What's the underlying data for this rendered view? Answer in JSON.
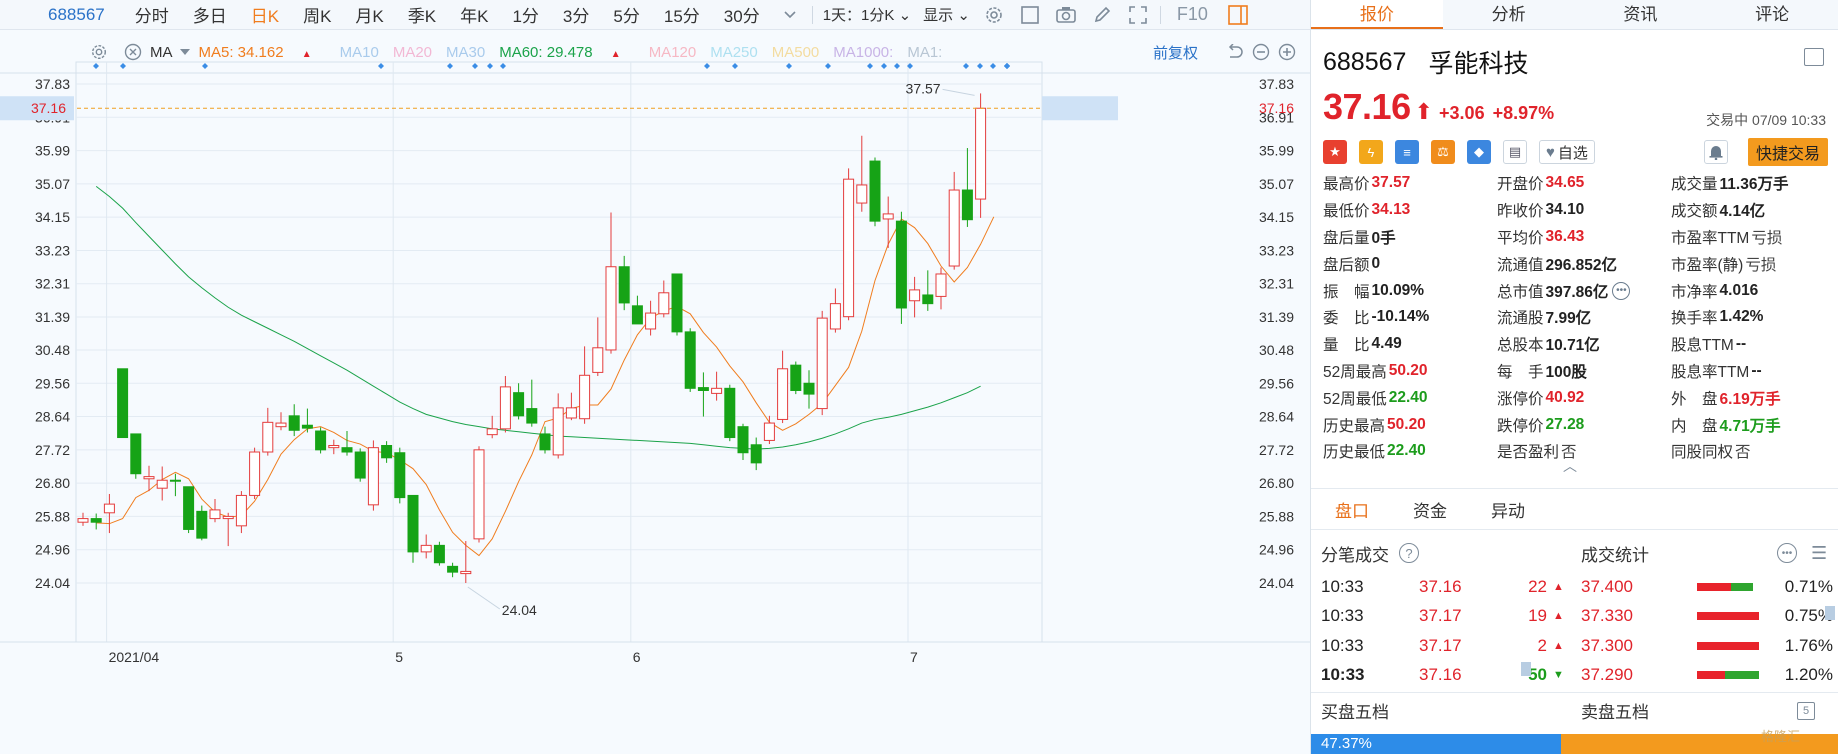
{
  "toolbar": {
    "code": "688567",
    "items": [
      "分时",
      "多日",
      "日K",
      "周K",
      "月K",
      "季K",
      "年K",
      "1分",
      "3分",
      "5分",
      "15分",
      "30分"
    ],
    "active_item": "日K",
    "range": "1天：1分K",
    "display": "显示",
    "f10": "F10"
  },
  "ma_bar": {
    "type": "MA",
    "ma5": "MA5: 34.162",
    "ma10": "MA10",
    "ma20": "MA20",
    "ma30": "MA30",
    "ma60": "MA60: 29.478",
    "ma120": "MA120",
    "ma250": "MA250",
    "ma500": "MA500",
    "ma1000": "MA1000:",
    "ma1": "MA1:",
    "adjust": "前复权",
    "colors": {
      "ma5": "#f07d1e",
      "ma60": "#1ba34a",
      "ma10": "#9fc6ea",
      "ma20": "#f2b6d4",
      "ma30": "#9fc6ea",
      "ma120": "#f6b8c4",
      "ma250": "#aee0f0",
      "ma500": "#f3dca0",
      "ma1000": "#c8b4e6",
      "ma1": "#b8c6d4"
    }
  },
  "chart_data": {
    "type": "candlestick",
    "y_ticks": [
      "37.83",
      "36.91",
      "35.99",
      "35.07",
      "34.15",
      "33.23",
      "32.31",
      "31.39",
      "30.48",
      "29.56",
      "28.64",
      "27.72",
      "26.80",
      "25.88",
      "24.96",
      "24.04"
    ],
    "ylim": [
      24.04,
      37.83
    ],
    "x_labels": [
      {
        "label": "2021/04",
        "index": 1
      },
      {
        "label": "5",
        "index": 24
      },
      {
        "label": "6",
        "index": 42
      },
      {
        "label": "7",
        "index": 63
      }
    ],
    "current_price_label": "37.16",
    "current_price": 37.16,
    "max_label": "37.57",
    "min_label": "24.04",
    "candles": [
      {
        "o": 25.72,
        "c": 25.82,
        "h": 25.98,
        "l": 25.62
      },
      {
        "o": 25.82,
        "c": 25.72,
        "h": 25.96,
        "l": 25.52
      },
      {
        "o": 25.98,
        "c": 26.22,
        "h": 26.5,
        "l": 25.42
      },
      {
        "o": 29.96,
        "c": 28.06,
        "h": 29.96,
        "l": 28.06
      },
      {
        "o": 28.16,
        "c": 27.06,
        "h": 28.16,
        "l": 26.92
      },
      {
        "o": 26.92,
        "c": 26.98,
        "h": 27.28,
        "l": 26.58
      },
      {
        "o": 26.66,
        "c": 26.88,
        "h": 27.26,
        "l": 26.32
      },
      {
        "o": 26.88,
        "c": 26.86,
        "h": 27.06,
        "l": 26.44
      },
      {
        "o": 26.7,
        "c": 25.52,
        "h": 26.7,
        "l": 25.42
      },
      {
        "o": 26.02,
        "c": 25.28,
        "h": 26.18,
        "l": 25.22
      },
      {
        "o": 25.82,
        "c": 26.06,
        "h": 26.36,
        "l": 25.72
      },
      {
        "o": 25.82,
        "c": 25.88,
        "h": 25.98,
        "l": 25.06
      },
      {
        "o": 25.62,
        "c": 26.46,
        "h": 26.58,
        "l": 25.42
      },
      {
        "o": 26.46,
        "c": 27.66,
        "h": 27.78,
        "l": 26.36
      },
      {
        "o": 27.66,
        "c": 28.48,
        "h": 28.88,
        "l": 27.56
      },
      {
        "o": 28.36,
        "c": 28.46,
        "h": 28.76,
        "l": 28.26
      },
      {
        "o": 28.66,
        "c": 28.26,
        "h": 28.98,
        "l": 28.1
      },
      {
        "o": 28.4,
        "c": 28.32,
        "h": 28.86,
        "l": 28.2
      },
      {
        "o": 28.24,
        "c": 27.72,
        "h": 28.34,
        "l": 27.62
      },
      {
        "o": 27.78,
        "c": 27.84,
        "h": 28.0,
        "l": 27.6
      },
      {
        "o": 27.78,
        "c": 27.66,
        "h": 28.24,
        "l": 27.56
      },
      {
        "o": 27.66,
        "c": 26.94,
        "h": 27.76,
        "l": 26.84
      },
      {
        "o": 26.2,
        "c": 27.78,
        "h": 27.98,
        "l": 26.04
      },
      {
        "o": 27.84,
        "c": 27.5,
        "h": 27.96,
        "l": 27.36
      },
      {
        "o": 27.64,
        "c": 26.4,
        "h": 27.78,
        "l": 26.24
      },
      {
        "o": 26.46,
        "c": 24.9,
        "h": 26.46,
        "l": 24.6
      },
      {
        "o": 24.9,
        "c": 25.08,
        "h": 25.38,
        "l": 24.72
      },
      {
        "o": 25.08,
        "c": 24.6,
        "h": 25.18,
        "l": 24.52
      },
      {
        "o": 24.5,
        "c": 24.34,
        "h": 24.6,
        "l": 24.2
      },
      {
        "o": 24.3,
        "c": 24.36,
        "h": 25.2,
        "l": 24.04
      },
      {
        "o": 25.26,
        "c": 27.72,
        "h": 27.82,
        "l": 25.16
      },
      {
        "o": 28.14,
        "c": 28.3,
        "h": 28.66,
        "l": 28.04
      },
      {
        "o": 28.3,
        "c": 29.46,
        "h": 29.76,
        "l": 28.2
      },
      {
        "o": 29.3,
        "c": 28.66,
        "h": 29.56,
        "l": 28.56
      },
      {
        "o": 28.86,
        "c": 28.46,
        "h": 29.66,
        "l": 28.36
      },
      {
        "o": 28.16,
        "c": 27.72,
        "h": 28.36,
        "l": 27.62
      },
      {
        "o": 27.58,
        "c": 28.88,
        "h": 29.28,
        "l": 27.48
      },
      {
        "o": 28.6,
        "c": 28.88,
        "h": 29.3,
        "l": 28.54
      },
      {
        "o": 28.58,
        "c": 29.78,
        "h": 30.58,
        "l": 28.44
      },
      {
        "o": 29.86,
        "c": 30.54,
        "h": 31.38,
        "l": 29.76
      },
      {
        "o": 30.48,
        "c": 32.78,
        "h": 34.28,
        "l": 30.38
      },
      {
        "o": 32.78,
        "c": 31.78,
        "h": 33.08,
        "l": 31.58
      },
      {
        "o": 31.7,
        "c": 31.2,
        "h": 31.98,
        "l": 31.2
      },
      {
        "o": 31.06,
        "c": 31.5,
        "h": 31.84,
        "l": 30.88
      },
      {
        "o": 31.48,
        "c": 32.06,
        "h": 32.4,
        "l": 31.38
      },
      {
        "o": 32.58,
        "c": 30.98,
        "h": 32.58,
        "l": 30.88
      },
      {
        "o": 30.98,
        "c": 29.42,
        "h": 31.08,
        "l": 29.32
      },
      {
        "o": 29.44,
        "c": 29.36,
        "h": 29.86,
        "l": 28.64
      },
      {
        "o": 29.28,
        "c": 29.42,
        "h": 29.88,
        "l": 29.08
      },
      {
        "o": 29.42,
        "c": 28.06,
        "h": 29.52,
        "l": 27.96
      },
      {
        "o": 28.36,
        "c": 27.64,
        "h": 28.44,
        "l": 27.44
      },
      {
        "o": 27.86,
        "c": 27.36,
        "h": 28.06,
        "l": 27.16
      },
      {
        "o": 27.98,
        "c": 28.46,
        "h": 28.66,
        "l": 27.88
      },
      {
        "o": 28.56,
        "c": 29.96,
        "h": 30.46,
        "l": 28.46
      },
      {
        "o": 30.06,
        "c": 29.36,
        "h": 30.16,
        "l": 29.26
      },
      {
        "o": 29.56,
        "c": 29.26,
        "h": 29.92,
        "l": 28.86
      },
      {
        "o": 28.86,
        "c": 31.36,
        "h": 31.56,
        "l": 28.68
      },
      {
        "o": 31.06,
        "c": 31.76,
        "h": 32.18,
        "l": 30.96
      },
      {
        "o": 31.4,
        "c": 35.2,
        "h": 35.5,
        "l": 31.3
      },
      {
        "o": 34.54,
        "c": 35.04,
        "h": 36.4,
        "l": 34.3
      },
      {
        "o": 35.7,
        "c": 34.04,
        "h": 35.8,
        "l": 33.9
      },
      {
        "o": 34.1,
        "c": 34.24,
        "h": 34.72,
        "l": 33.3
      },
      {
        "o": 34.04,
        "c": 31.64,
        "h": 34.3,
        "l": 31.2
      },
      {
        "o": 31.84,
        "c": 32.14,
        "h": 32.5,
        "l": 31.38
      },
      {
        "o": 32.0,
        "c": 31.76,
        "h": 32.68,
        "l": 31.56
      },
      {
        "o": 31.96,
        "c": 32.58,
        "h": 32.76,
        "l": 31.6
      },
      {
        "o": 32.8,
        "c": 34.9,
        "h": 35.4,
        "l": 32.7
      },
      {
        "o": 34.9,
        "c": 34.08,
        "h": 36.06,
        "l": 33.88
      },
      {
        "o": 34.65,
        "c": 37.16,
        "h": 37.57,
        "l": 34.13
      }
    ],
    "ma5": [
      25.7,
      25.68,
      25.82,
      26.4,
      26.6,
      26.9,
      27.1,
      26.92,
      26.36,
      26.0,
      25.86,
      25.9,
      26.3,
      26.9,
      27.6,
      28.0,
      28.3,
      28.36,
      28.2,
      27.98,
      27.88,
      27.68,
      27.64,
      27.44,
      27.2,
      26.76,
      26.06,
      25.44,
      25.08,
      24.8,
      25.26,
      26.02,
      26.84,
      27.58,
      28.5,
      28.6,
      28.86,
      28.96,
      28.96,
      29.4,
      30.2,
      30.9,
      31.36,
      31.56,
      31.68,
      31.48,
      30.96,
      30.56,
      30.04,
      29.6,
      29.02,
      28.48,
      28.26,
      28.44,
      28.7,
      29.0,
      29.5,
      30.0,
      31.0,
      32.4,
      33.4,
      34.1,
      33.86,
      33.42,
      32.8,
      32.36,
      32.76,
      33.4,
      34.16
    ],
    "ma60": [
      null,
      35.0,
      34.72,
      34.4,
      34.0,
      33.62,
      33.24,
      32.86,
      32.5,
      32.2,
      31.92,
      31.66,
      31.44,
      31.26,
      31.08,
      30.9,
      30.72,
      30.52,
      30.32,
      30.12,
      29.92,
      29.7,
      29.48,
      29.26,
      29.04,
      28.86,
      28.7,
      28.6,
      28.5,
      28.42,
      28.36,
      28.3,
      28.26,
      28.22,
      28.18,
      28.14,
      28.1,
      28.08,
      28.06,
      28.04,
      28.02,
      28.0,
      27.98,
      27.96,
      27.94,
      27.92,
      27.9,
      27.86,
      27.82,
      27.78,
      27.76,
      27.74,
      27.76,
      27.8,
      27.86,
      27.94,
      28.04,
      28.16,
      28.3,
      28.46,
      28.56,
      28.62,
      28.7,
      28.8,
      28.9,
      29.02,
      29.16,
      29.3,
      29.48
    ],
    "dot_indices": [
      0,
      1,
      5,
      13,
      16,
      17,
      18,
      19,
      26,
      27,
      32,
      33,
      36,
      40,
      42,
      43,
      44,
      45,
      46,
      50,
      51,
      52,
      53
    ],
    "colors": {
      "up": "#e43c3c",
      "down": "#16a316",
      "ma5": "#f07d1e",
      "ma60": "#1ba34a",
      "price_line": "#f0a020",
      "dot": "#3b8de6",
      "grid": "#e3ebf3"
    }
  },
  "panel": {
    "tabs": [
      "报价",
      "分析",
      "资讯",
      "评论"
    ],
    "active_tab": "报价",
    "code": "688567",
    "name": "孚能科技",
    "price": "37.16",
    "change": "+3.06",
    "change_pct": "+8.97%",
    "trade_time": "交易中 07/09 10:33",
    "zixuan": "自选",
    "quick_trade": "快捷交易",
    "stats": [
      [
        {
          "l": "最高价",
          "v": "37.57",
          "c": "red"
        },
        {
          "l": "开盘价",
          "v": "34.65",
          "c": "red"
        },
        {
          "l": "成交量",
          "v": "11.36万手",
          "c": ""
        }
      ],
      [
        {
          "l": "最低价",
          "v": "34.13",
          "c": "red"
        },
        {
          "l": "昨收价",
          "v": "34.10",
          "c": ""
        },
        {
          "l": "成交额",
          "v": "4.14亿",
          "c": ""
        }
      ],
      [
        {
          "l": "盘后量",
          "v": "0手",
          "c": ""
        },
        {
          "l": "平均价",
          "v": "36.43",
          "c": "red"
        },
        {
          "l": "市盈率TTM",
          "v": "亏损",
          "c": "grey"
        }
      ],
      [
        {
          "l": "盘后额",
          "v": "0",
          "c": ""
        },
        {
          "l": "流通值",
          "v": "296.852亿",
          "c": ""
        },
        {
          "l": "市盈率(静)",
          "v": "亏损",
          "c": "grey"
        }
      ],
      [
        {
          "l": "振　幅",
          "v": "10.09%",
          "c": ""
        },
        {
          "l": "总市值",
          "v": "397.86亿",
          "c": ""
        },
        {
          "l": "市净率",
          "v": "4.016",
          "c": ""
        }
      ],
      [
        {
          "l": "委　比",
          "v": "-10.14%",
          "c": ""
        },
        {
          "l": "流通股",
          "v": "7.99亿",
          "c": ""
        },
        {
          "l": "换手率",
          "v": "1.42%",
          "c": ""
        }
      ],
      [
        {
          "l": "量　比",
          "v": "4.49",
          "c": ""
        },
        {
          "l": "总股本",
          "v": "10.71亿",
          "c": ""
        },
        {
          "l": "股息TTM",
          "v": "--",
          "c": ""
        }
      ],
      [
        {
          "l": "52周最高",
          "v": "50.20",
          "c": "red"
        },
        {
          "l": "每　手",
          "v": "100股",
          "c": ""
        },
        {
          "l": "股息率TTM",
          "v": "--",
          "c": ""
        }
      ],
      [
        {
          "l": "52周最低",
          "v": "22.40",
          "c": "green"
        },
        {
          "l": "涨停价",
          "v": "40.92",
          "c": "red"
        },
        {
          "l": "外　盘",
          "v": "6.19万手",
          "c": "red"
        }
      ],
      [
        {
          "l": "历史最高",
          "v": "50.20",
          "c": "red"
        },
        {
          "l": "跌停价",
          "v": "27.28",
          "c": "green"
        },
        {
          "l": "内　盘",
          "v": "4.71万手",
          "c": "green"
        }
      ],
      [
        {
          "l": "历史最低",
          "v": "22.40",
          "c": "green"
        },
        {
          "l": "是否盈利",
          "v": "否",
          "c": "grey"
        },
        {
          "l": "同股同权",
          "v": "否",
          "c": "grey"
        }
      ]
    ],
    "subtabs": [
      "盘口",
      "资金",
      "异动"
    ],
    "active_subtab": "盘口",
    "ticks_title": "分笔成交",
    "stats_title": "成交统计",
    "ticks": [
      {
        "time": "10:33",
        "price": "37.16",
        "vol": "22",
        "dir": "up"
      },
      {
        "time": "10:33",
        "price": "37.17",
        "vol": "19",
        "dir": "up"
      },
      {
        "time": "10:33",
        "price": "37.17",
        "vol": "2",
        "dir": "up"
      },
      {
        "time": "10:33",
        "price": "37.16",
        "vol": "50",
        "dir": "down"
      }
    ],
    "vol_stats": [
      {
        "price": "37.400",
        "pct": "0.71%",
        "red": 0.55,
        "green": 0.35
      },
      {
        "price": "37.330",
        "pct": "0.75%",
        "red": 1.0,
        "green": 0
      },
      {
        "price": "37.300",
        "pct": "1.76%",
        "red": 1.0,
        "green": 0
      },
      {
        "price": "37.290",
        "pct": "1.20%",
        "red": 0.45,
        "green": 0.55
      }
    ],
    "buy_book": "买盘五档",
    "sell_book": "卖盘五档",
    "buy_ratio": "47.37%",
    "watermark": "格隆汇"
  }
}
